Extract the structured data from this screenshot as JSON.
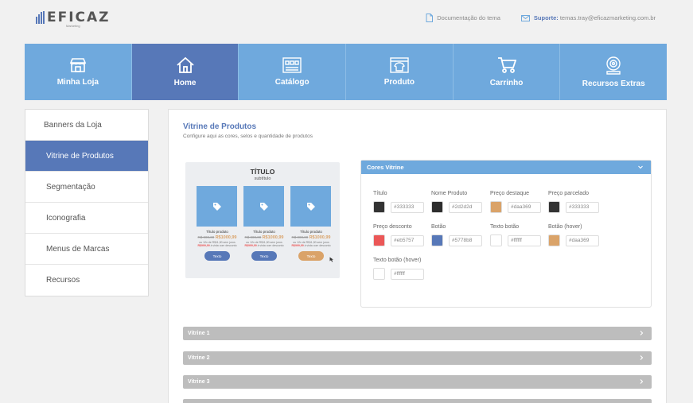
{
  "header": {
    "logo_text": "EFICAZ",
    "logo_sub": "Marketing",
    "doc_link": "Documentação do tema",
    "support_label": "Suporte:",
    "support_email": "temas.tray@eficazmarketing.com.br"
  },
  "nav": {
    "items": [
      {
        "label": "Minha Loja",
        "icon": "store-icon"
      },
      {
        "label": "Home",
        "icon": "home-icon"
      },
      {
        "label": "Catálogo",
        "icon": "catalog-icon"
      },
      {
        "label": "Produto",
        "icon": "product-icon"
      },
      {
        "label": "Carrinho",
        "icon": "cart-icon"
      },
      {
        "label": "Recursos Extras",
        "icon": "extras-icon"
      }
    ],
    "active": "Home",
    "colors": {
      "bar": "#6fa9dd",
      "active": "#5778b8"
    }
  },
  "sidebar": {
    "items": [
      {
        "label": "Banners da Loja"
      },
      {
        "label": "Vitrine de Produtos"
      },
      {
        "label": "Segmentação"
      },
      {
        "label": "Iconografia"
      },
      {
        "label": "Menus de Marcas"
      },
      {
        "label": "Recursos"
      }
    ],
    "active": "Vitrine de Produtos"
  },
  "main": {
    "title": "Vitrine de Produtos",
    "subtitle": "Configure aqui as cores, selos e quantidade de produtos"
  },
  "preview": {
    "title": "TÍTULO",
    "subtitle": "subtítulo",
    "cards": [
      {
        "name": "Título produto",
        "old_price": "R$ 000,00",
        "price": "R$1000,99",
        "installment": "ou 12x de R$11,50 sem juros",
        "discount_price": "R$999,99",
        "discount_text": "à vista com desconto",
        "button": "Texto"
      },
      {
        "name": "Título produto",
        "old_price": "R$ 000,00",
        "price": "R$1000,99",
        "installment": "ou 12x de R$11,50 sem juros",
        "discount_price": "R$999,99",
        "discount_text": "à vista com desconto",
        "button": "Texto"
      },
      {
        "name": "Título produto",
        "old_price": "R$ 000,00",
        "price": "R$1000,99",
        "installment": "ou 12x de R$11,50 sem juros",
        "discount_price": "R$999,99",
        "discount_text": "à vista com desconto",
        "button": "Texto"
      }
    ]
  },
  "colors_panel": {
    "title": "Cores Vitrine",
    "fields": [
      {
        "label": "Título",
        "value": "#333333",
        "swatch": "#333333"
      },
      {
        "label": "Nome Produto",
        "value": "#2d2d2d",
        "swatch": "#2d2d2d"
      },
      {
        "label": "Preço destaque",
        "value": "#daa369",
        "swatch": "#daa369"
      },
      {
        "label": "Preço parcelado",
        "value": "#333333",
        "swatch": "#333333"
      },
      {
        "label": "Preço desconto",
        "value": "#eb5757",
        "swatch": "#eb5757"
      },
      {
        "label": "Botão",
        "value": "#5778b8",
        "swatch": "#5778b8"
      },
      {
        "label": "Texto botão",
        "value": "#ffffff",
        "swatch": "#ffffff"
      },
      {
        "label": "Botão (hover)",
        "value": "#daa369",
        "swatch": "#daa369"
      },
      {
        "label": "Texto botão (hover)",
        "value": "#ffffff",
        "swatch": "#ffffff"
      }
    ]
  },
  "accordions": [
    {
      "label": "Vitrine 1"
    },
    {
      "label": "Vitrine 2"
    },
    {
      "label": "Vitrine 3"
    }
  ]
}
